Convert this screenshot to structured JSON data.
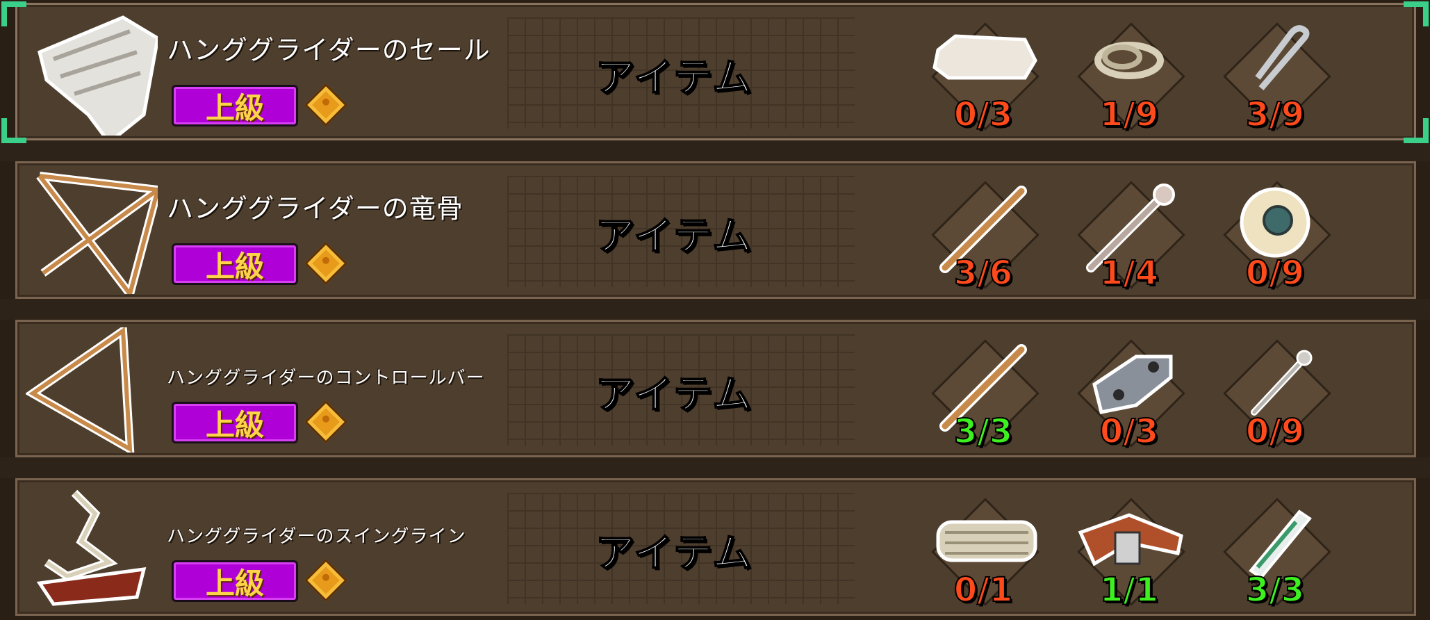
{
  "category_label": "アイテム",
  "grade_label": "上級",
  "colors": {
    "lack": "#ff4a1c",
    "ok": "#3ef020",
    "grade_bg": "#b000d8"
  },
  "rows": [
    {
      "name": "ハンググライダーのセール",
      "icon": "glider-sail-icon",
      "materials": [
        {
          "icon": "cloth-icon",
          "count": "0/3",
          "status": "lack"
        },
        {
          "icon": "rope-icon",
          "count": "1/9",
          "status": "lack"
        },
        {
          "icon": "clip-icon",
          "count": "3/9",
          "status": "lack"
        }
      ]
    },
    {
      "name": "ハンググライダーの竜骨",
      "icon": "glider-keel-icon",
      "materials": [
        {
          "icon": "wooden-stick-icon",
          "count": "3/6",
          "status": "lack"
        },
        {
          "icon": "bolt-icon",
          "count": "1/4",
          "status": "lack"
        },
        {
          "icon": "tape-roll-icon",
          "count": "0/9",
          "status": "lack"
        }
      ]
    },
    {
      "name": "ハンググライダーのコントロールバー",
      "icon": "glider-control-bar-icon",
      "materials": [
        {
          "icon": "wooden-stick-icon",
          "count": "3/3",
          "status": "ok"
        },
        {
          "icon": "metal-bracket-icon",
          "count": "0/3",
          "status": "lack"
        },
        {
          "icon": "pin-icon",
          "count": "0/9",
          "status": "lack"
        }
      ]
    },
    {
      "name": "ハンググライダーのスイングライン",
      "icon": "glider-swing-line-icon",
      "materials": [
        {
          "icon": "rope-bundle-icon",
          "count": "0/1",
          "status": "lack"
        },
        {
          "icon": "belt-icon",
          "count": "1/1",
          "status": "ok"
        },
        {
          "icon": "glue-tube-icon",
          "count": "3/3",
          "status": "ok"
        }
      ]
    }
  ]
}
